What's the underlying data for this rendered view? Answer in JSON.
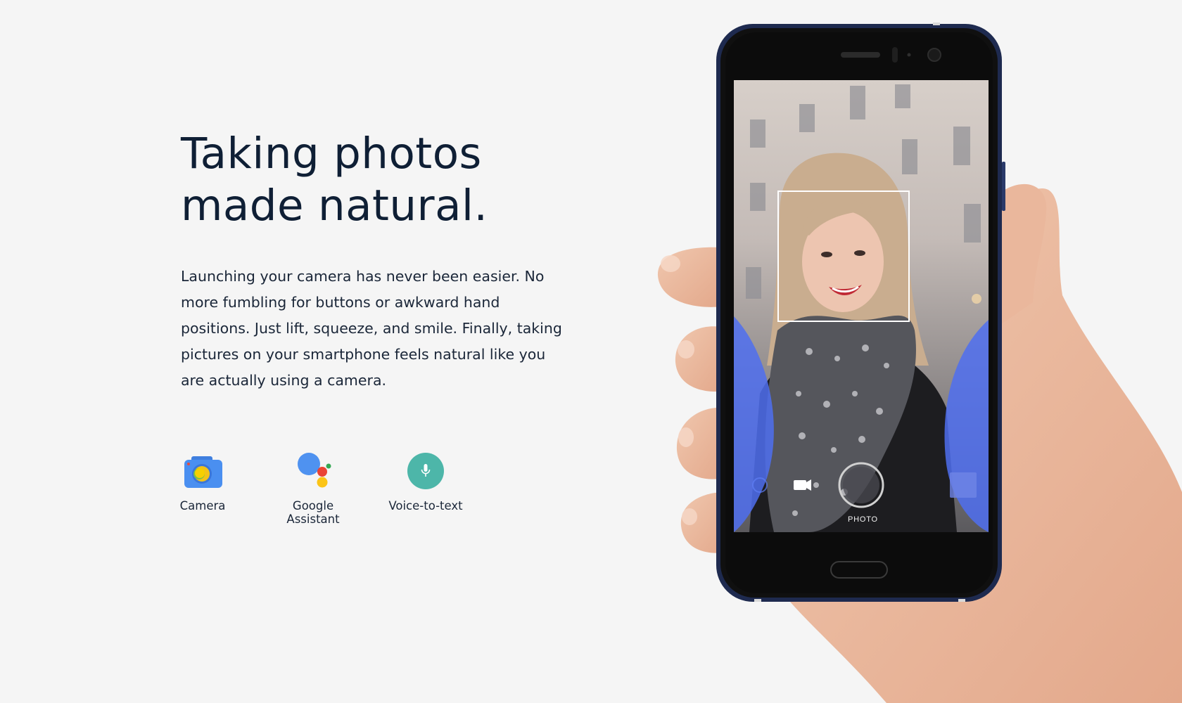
{
  "hero": {
    "headline_line1": "Taking photos",
    "headline_line2": "made natural.",
    "body_lines": [
      "Launching your camera has never been easier. No",
      "more fumbling for buttons or awkward hand",
      "positions. Just lift, squeeze, and smile. Finally, taking",
      "pictures on your smartphone feels natural like you",
      "are actually using a camera."
    ]
  },
  "features": [
    {
      "label": "Camera",
      "icon": "camera-app-icon"
    },
    {
      "label": "Google Assistant",
      "icon": "google-assistant-icon"
    },
    {
      "label": "Voice-to-text",
      "icon": "microphone-icon"
    }
  ],
  "phone": {
    "camera_mode": "PHOTO"
  },
  "colors": {
    "background": "#f5f5f5",
    "heading": "#0f1f35",
    "body_text": "#1a2638",
    "accent_blue": "#4f6ff0",
    "voice_teal": "#4db6a9",
    "assistant_blue": "#4285f4",
    "assistant_red": "#ea4335",
    "assistant_yellow": "#fbbc05",
    "assistant_green": "#34a853"
  }
}
